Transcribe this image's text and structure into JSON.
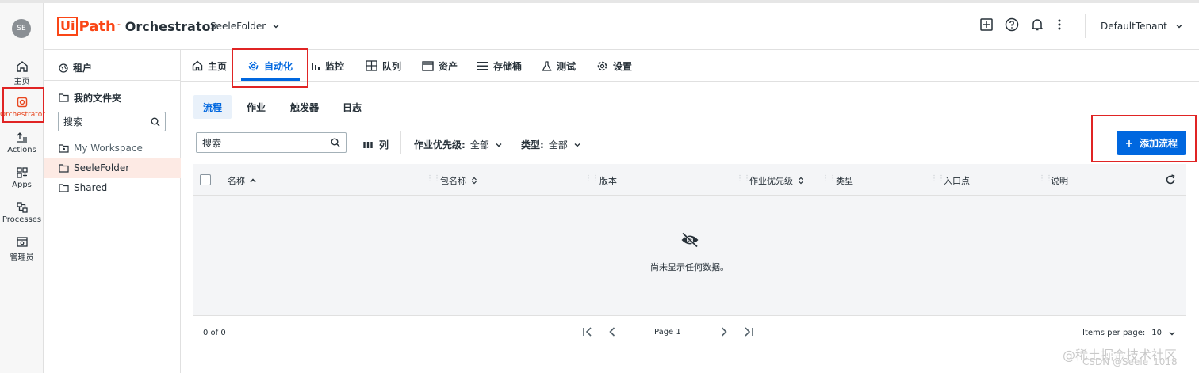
{
  "app": {
    "logo_box": "Ui",
    "logo_path": "Path",
    "logo_tm": "™",
    "product": "Orchestrator",
    "folder": "SeeleFolder",
    "tenant": "DefaultTenant"
  },
  "user": {
    "initials": "SE"
  },
  "rail": [
    {
      "label": "主页"
    },
    {
      "label": "Orchestrator"
    },
    {
      "label": "Actions"
    },
    {
      "label": "Apps"
    },
    {
      "label": "Processes"
    },
    {
      "label": "管理员"
    }
  ],
  "folders": {
    "tenant": "租户",
    "my_folders": "我的文件夹",
    "search_placeholder": "搜索",
    "items": [
      "My Workspace",
      "SeeleFolder",
      "Shared"
    ]
  },
  "tabs": [
    "主页",
    "自动化",
    "监控",
    "队列",
    "资产",
    "存储桶",
    "测试",
    "设置"
  ],
  "subtabs": [
    "流程",
    "作业",
    "触发器",
    "日志"
  ],
  "toolbar": {
    "search_placeholder": "搜索",
    "columns": "列",
    "priority_label": "作业优先级:",
    "priority_value": "全部",
    "type_label": "类型:",
    "type_value": "全部",
    "add_button": "添加流程"
  },
  "table": {
    "columns": [
      "名称",
      "包名称",
      "版本",
      "作业优先级",
      "类型",
      "入口点",
      "说明"
    ],
    "empty_text": "尚未显示任何数据。"
  },
  "footer": {
    "count": "0 of 0",
    "page": "Page 1",
    "items_per_page_label": "Items per page:",
    "items_per_page": "10"
  },
  "watermark": {
    "line1": "@稀土掘金技术社区",
    "line2": "CSDN @Seele_1018"
  },
  "colors": {
    "brand": "#fa4616",
    "primary": "#0067df",
    "highlight": "#e02424"
  }
}
